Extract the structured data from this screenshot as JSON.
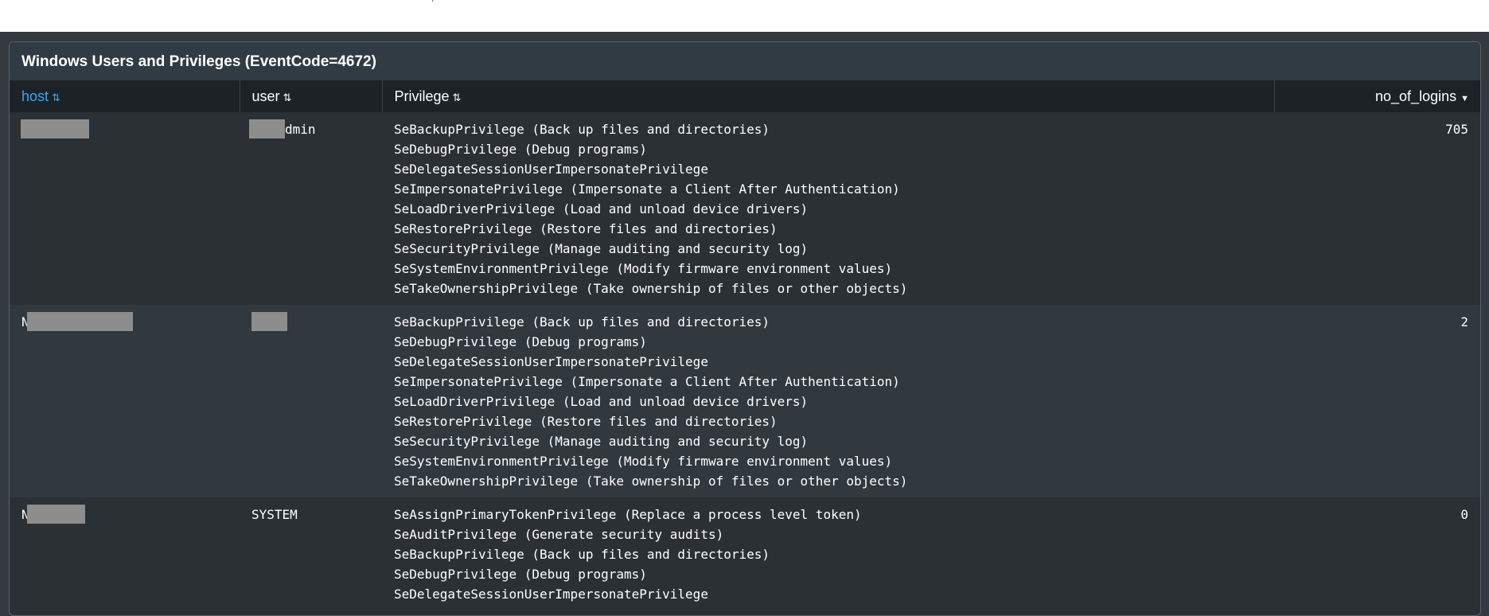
{
  "panel": {
    "title": "Windows Users and Privileges (EventCode=4672)"
  },
  "table": {
    "columns": [
      {
        "label": "host",
        "sort_icon": "sort-both-icon",
        "active": true
      },
      {
        "label": "user",
        "sort_icon": "sort-both-icon",
        "active": false
      },
      {
        "label": "Privilege",
        "sort_icon": "sort-both-icon",
        "active": false
      },
      {
        "label": "no_of_logins",
        "sort_icon": "sort-descending-icon",
        "active": false
      }
    ],
    "rows": [
      {
        "host": "",
        "user": "dmin",
        "privileges": [
          "SeBackupPrivilege (Back up files and directories)",
          "SeDebugPrivilege (Debug programs)",
          "SeDelegateSessionUserImpersonatePrivilege",
          "SeImpersonatePrivilege (Impersonate a Client After Authentication)",
          "SeLoadDriverPrivilege (Load and unload device drivers)",
          "SeRestorePrivilege (Restore files and directories)",
          "SeSecurityPrivilege (Manage auditing and security log)",
          "SeSystemEnvironmentPrivilege (Modify firmware environment values)",
          "SeTakeOwnershipPrivilege (Take ownership of files or other objects)"
        ],
        "no_of_logins": "705"
      },
      {
        "host": "N",
        "user": "",
        "privileges": [
          "SeBackupPrivilege (Back up files and directories)",
          "SeDebugPrivilege (Debug programs)",
          "SeDelegateSessionUserImpersonatePrivilege",
          "SeImpersonatePrivilege (Impersonate a Client After Authentication)",
          "SeLoadDriverPrivilege (Load and unload device drivers)",
          "SeRestorePrivilege (Restore files and directories)",
          "SeSecurityPrivilege (Manage auditing and security log)",
          "SeSystemEnvironmentPrivilege (Modify firmware environment values)",
          "SeTakeOwnershipPrivilege (Take ownership of files or other objects)"
        ],
        "no_of_logins": "2"
      },
      {
        "host": "N",
        "user": "SYSTEM",
        "privileges": [
          "SeAssignPrimaryTokenPrivilege (Replace a process level token)",
          "SeAuditPrivilege (Generate security audits)",
          "SeBackupPrivilege (Back up files and directories)",
          "SeDebugPrivilege (Debug programs)",
          "SeDelegateSessionUserImpersonatePrivilege"
        ],
        "no_of_logins": "0"
      }
    ]
  }
}
